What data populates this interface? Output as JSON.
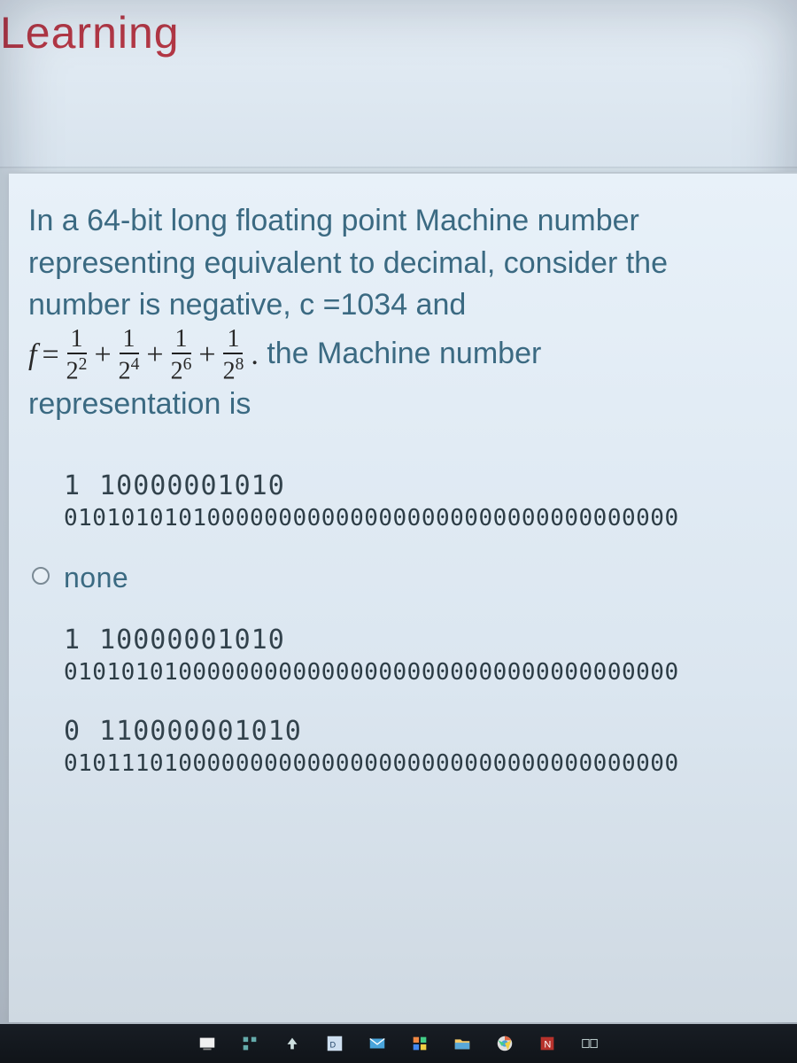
{
  "header": {
    "title": "Learning"
  },
  "question": {
    "line1": "In a 64-bit long floating point Machine number",
    "line2": "representing equivalent to decimal, consider the",
    "line3_a": "number is negative, c =1034 and",
    "f_lhs": "f",
    "eq": "=",
    "plus": "+",
    "num": "1",
    "den_base": "2",
    "den_exp1": "2",
    "den_exp2": "4",
    "den_exp3": "6",
    "den_exp4": "8",
    "period": ".",
    "line4_tail": " the Machine number",
    "line5": "representation is"
  },
  "options": [
    {
      "kind": "binary",
      "radio_visible": false,
      "l1": "1 10000001010",
      "l2": "0101010101000000000000000000000000000000000"
    },
    {
      "kind": "none",
      "radio_visible": true,
      "l1": "none",
      "l2": ""
    },
    {
      "kind": "binary",
      "radio_visible": false,
      "l1": "1 10000001010",
      "l2": "0101010100000000000000000000000000000000000"
    },
    {
      "kind": "binary",
      "radio_visible": false,
      "l1": "0 110000001010",
      "l2": "0101110100000000000000000000000000000000000"
    }
  ],
  "taskbar": {
    "items": [
      "whiteboard-icon",
      "devtools-icon",
      "up-arrow-icon",
      "devcpp-icon",
      "mail-icon",
      "apps-icon",
      "explorer-icon",
      "chrome-icon",
      "nvidia-icon",
      "taskview-icon"
    ]
  }
}
